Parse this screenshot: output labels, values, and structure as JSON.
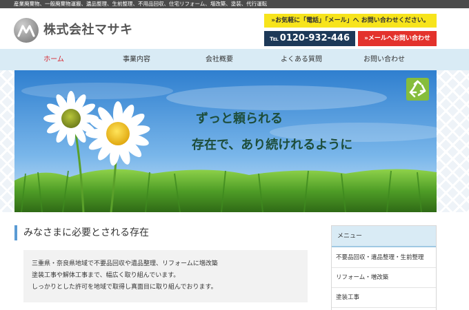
{
  "topbar": {
    "text": "産業廃棄物、一般廃棄物運搬、遺品整理、生前整理、不用品回収、住宅リフォーム、増改築、塗装、代行運転"
  },
  "header": {
    "company_name": "株式会社マサキ",
    "contact_banner": "»お気軽に「電話」「メール」へ お問い合わせください。",
    "phone_prefix": "℡",
    "phone_number": "0120-932-446",
    "mail_button": "»メールへお問い合わせ"
  },
  "nav": {
    "items": [
      {
        "label": "ホーム",
        "active": true
      },
      {
        "label": "事業内容"
      },
      {
        "label": "会社概要"
      },
      {
        "label": "よくある質問"
      },
      {
        "label": "お問い合わせ"
      }
    ]
  },
  "hero": {
    "tagline_1": "ずっと頼られる",
    "tagline_2": "存在で、あり続けれるように",
    "recycle_icon": "recycle-icon"
  },
  "main": {
    "section_title": "みなさまに必要とされる存在",
    "intro_lines": [
      "三重県・奈良県地域で不要品回収や遺品整理、リフォームに増改築",
      "塗装工事や解体工事まで、幅広く取り組んでいます。",
      "しっかりとした許可を地域で取得し真面目に取り組んでおります。"
    ]
  },
  "sidebar": {
    "header": "メニュー",
    "items": [
      {
        "label": "不要品回収・遺品整理・生前整理"
      },
      {
        "label": "リフォーム・増改築"
      },
      {
        "label": "塗装工事"
      }
    ]
  },
  "colors": {
    "topbar": "#4b4b4b",
    "nav_bg": "#d9ebf5",
    "active_nav": "#d7262f",
    "banner_yellow": "#f7e41c",
    "phone_navy": "#1d3958",
    "mail_red": "#e3322c",
    "accent_blue": "#5a9bd4",
    "recycle_green": "#86bd3c"
  }
}
